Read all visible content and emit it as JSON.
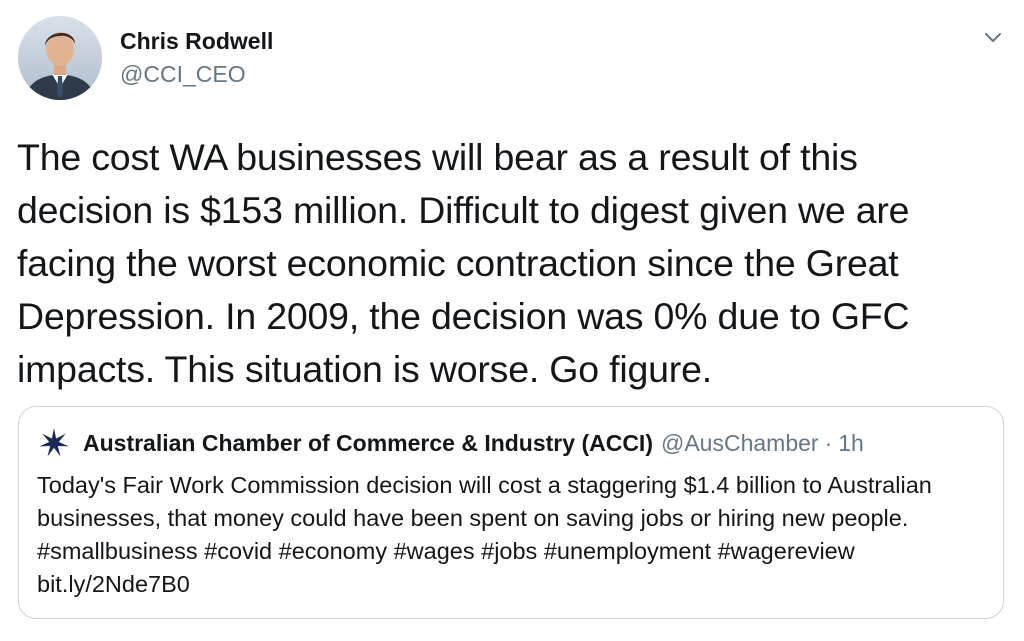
{
  "tweet": {
    "author_name": "Chris Rodwell",
    "author_handle": "@CCI_CEO",
    "text": "The cost WA businesses will bear as a result of this decision is $153 million. Difficult to digest given we are facing the worst economic contraction since the Great Depression. In 2009, the decision was 0% due to GFC impacts. This situation is worse. Go figure."
  },
  "quoted_tweet": {
    "author_name": "Australian Chamber of Commerce & Industry (ACCI)",
    "author_handle": "@AusChamber",
    "separator": "·",
    "time": "1h",
    "text": "Today's Fair Work Commission decision will cost a staggering $1.4 billion to Australian businesses, that money could have been spent on saving jobs or hiring new people. #smallbusiness #covid #economy #wages #jobs #unemployment #wagereview bit.ly/2Nde7B0"
  },
  "icons": {
    "menu": "chevron-down-icon",
    "quoted_avatar": "star-logo"
  },
  "colors": {
    "text_primary": "#14171a",
    "text_secondary": "#657786",
    "border": "#ccd6dd",
    "acci_star": "#1b2a5c"
  }
}
